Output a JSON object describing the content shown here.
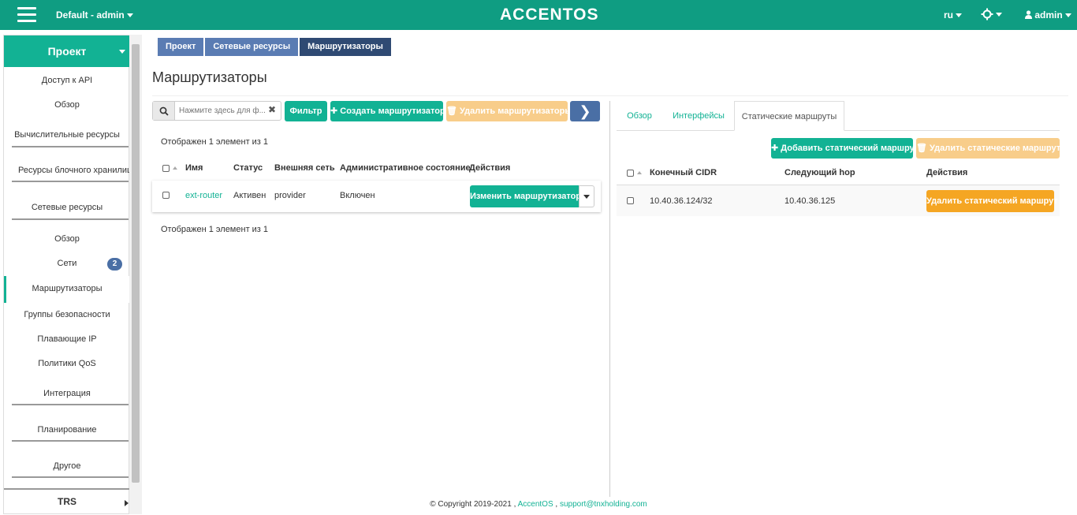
{
  "topbar": {
    "project_selector": "Default - admin",
    "brand": "ACCENTOS",
    "language": "ru",
    "user": "admin"
  },
  "sidebar": {
    "section": "Проект",
    "items": [
      {
        "label": "Доступ к API"
      },
      {
        "label": "Обзор"
      },
      {
        "label": "Вычислительные ресурсы"
      },
      {
        "label": "Ресурсы блочного хранилища"
      },
      {
        "label": "Сетевые ресурсы"
      },
      {
        "label": "Обзор"
      },
      {
        "label": "Сети",
        "badge": "2"
      },
      {
        "label": "Маршрутизаторы"
      },
      {
        "label": "Группы безопасности"
      },
      {
        "label": "Плавающие IP"
      },
      {
        "label": "Политики QoS"
      },
      {
        "label": "Интеграция"
      },
      {
        "label": "Планирование"
      },
      {
        "label": "Другое"
      },
      {
        "label": "TRS"
      }
    ]
  },
  "breadcrumb": [
    "Проект",
    "Сетевые ресурсы",
    "Маршрутизаторы"
  ],
  "page_title": "Маршрутизаторы",
  "toolbar": {
    "search_placeholder": "Нажмите здесь для ф...",
    "filter_label": "Фильтр",
    "create_label": "Создать маршрутизатор",
    "delete_label": "Удалить маршрутизаторы"
  },
  "routers_table": {
    "count_text": "Отображен 1 элемент из 1",
    "columns": [
      "Имя",
      "Статус",
      "Внешняя сеть",
      "Административное состояние",
      "Действия"
    ],
    "rows": [
      {
        "name": "ext-router",
        "status": "Активен",
        "network": "provider",
        "admin_state": "Включен",
        "action": "Изменить маршрутизатор"
      }
    ]
  },
  "detail": {
    "tabs": [
      "Обзор",
      "Интерфейсы",
      "Статические маршруты"
    ],
    "active_tab": 2,
    "add_label": "Добавить статический маршрут",
    "delete_label": "Удалить статические маршруты",
    "columns": [
      "Конечный CIDR",
      "Следующий hop",
      "Действия"
    ],
    "rows": [
      {
        "cidr": "10.40.36.124/32",
        "next_hop": "10.40.36.125",
        "action": "Удалить статический маршрут"
      }
    ]
  },
  "footer": {
    "copyright": "© Copyright 2019-2021 ,",
    "company": "AccentOS",
    "separator": ",",
    "email": "support@tnxholding.com"
  },
  "colors": {
    "accent": "#12b294",
    "topbar": "#0f9d82",
    "warning": "#f5a623",
    "breadcrumb": "#5a7cb3"
  }
}
